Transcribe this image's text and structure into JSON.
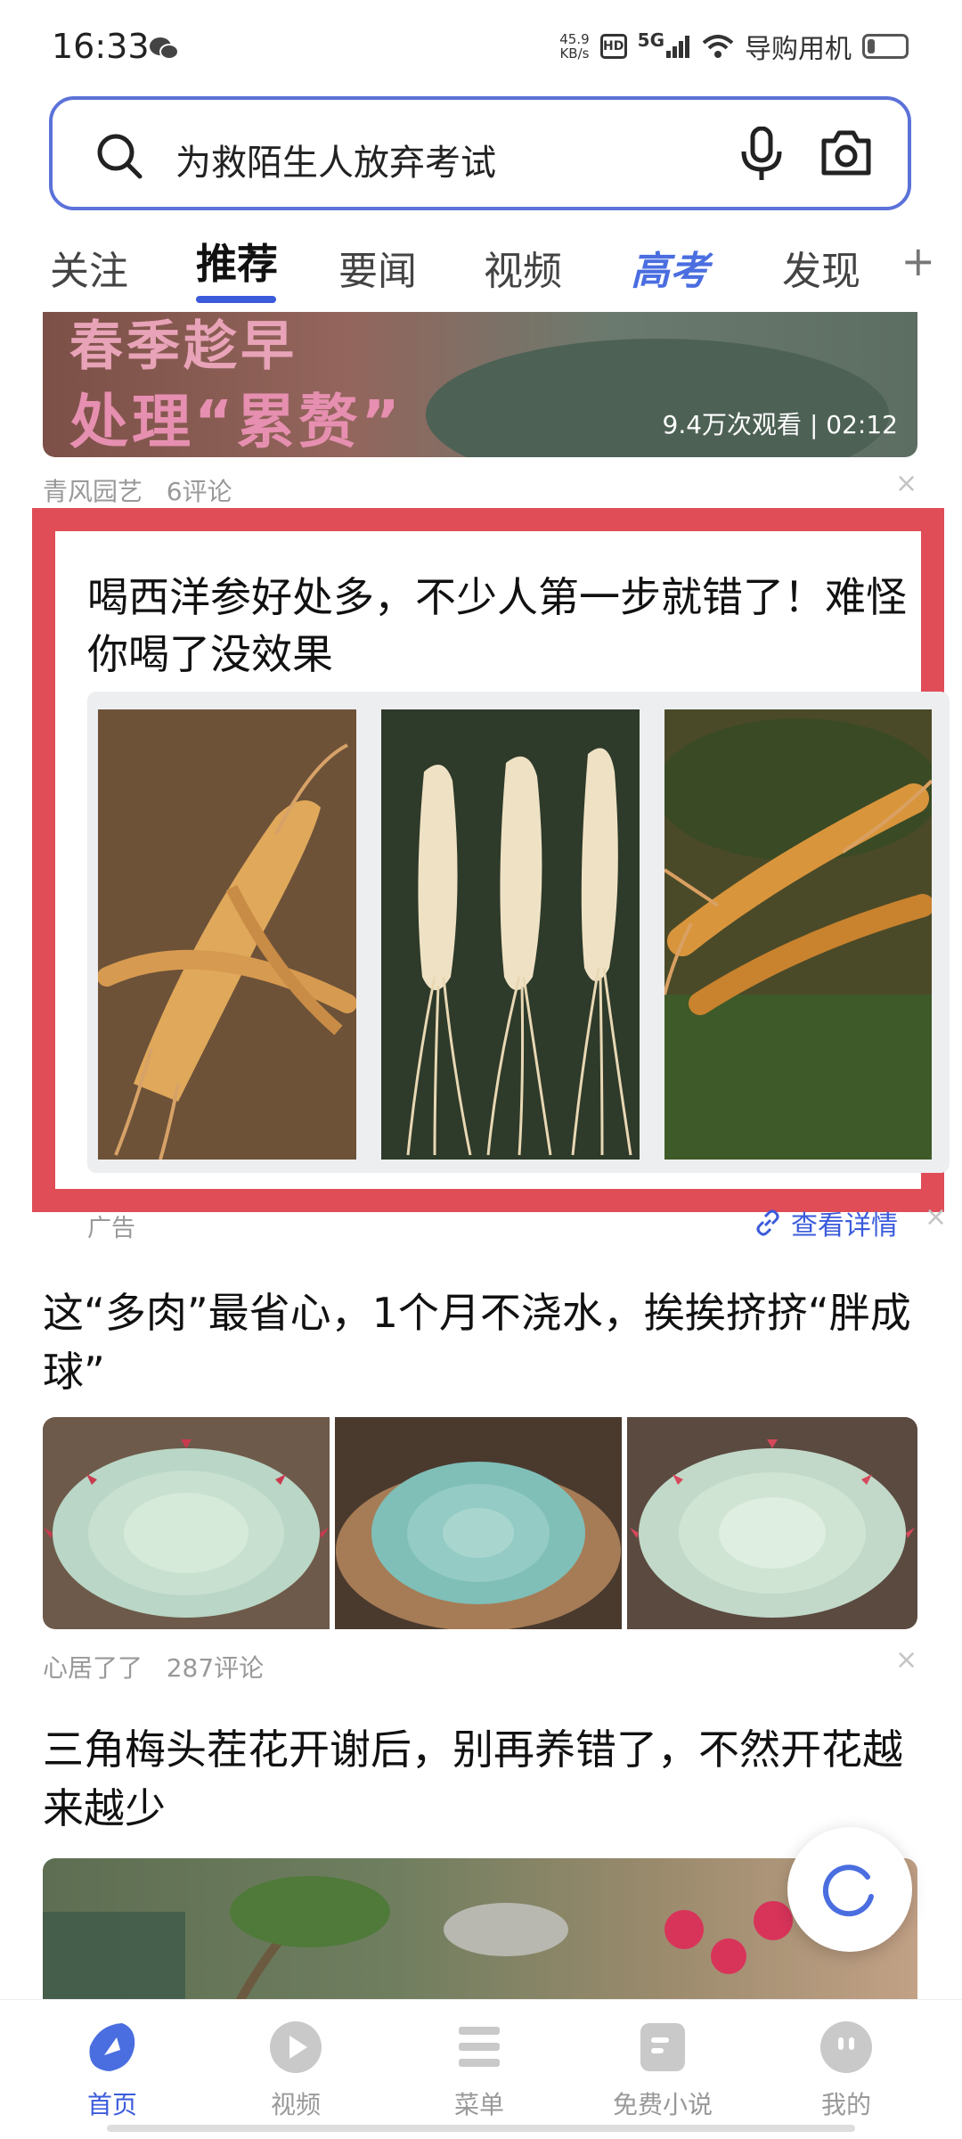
{
  "status_bar": {
    "time": "16:33",
    "net_speed_value": "45.9",
    "net_speed_unit": "KB/s",
    "hd_label": "HD",
    "network": "5G",
    "carrier": "导购用机",
    "battery_level": 0.2
  },
  "search": {
    "query": "为救陌生人放弃考试"
  },
  "tabs": [
    {
      "label": "关注"
    },
    {
      "label": "推荐"
    },
    {
      "label": "要闻"
    },
    {
      "label": "视频"
    },
    {
      "label": "高考"
    },
    {
      "label": "发现"
    }
  ],
  "tab_plus": "+",
  "feed": {
    "item1": {
      "overlay_line1": "春季趁早",
      "overlay_line2": "处理“累赘”",
      "views_duration": "9.4万次观看 | 02:12",
      "source": "青风园艺",
      "comments": "6评论"
    },
    "ad": {
      "title": "喝西洋参好处多，不少人第一步就错了！难怪你喝了没效果",
      "tag": "广告",
      "detail_label": "查看详情"
    },
    "item2": {
      "title": "这“多肉”最省心，1个月不浇水，挨挨挤挤“胖成球”",
      "source": "心居了了",
      "comments": "287评论"
    },
    "item3": {
      "title": "三角梅头茬花开谢后，别再养错了，不然开花越来越少"
    },
    "close_symbol": "×"
  },
  "bottom_nav": [
    {
      "label": "首页",
      "icon": "home-icon"
    },
    {
      "label": "视频",
      "icon": "play-icon"
    },
    {
      "label": "菜单",
      "icon": "menu-icon"
    },
    {
      "label": "免费小说",
      "icon": "book-icon"
    },
    {
      "label": "我的",
      "icon": "profile-icon"
    }
  ],
  "colors": {
    "accent": "#3b5bdb",
    "highlight_frame": "#e04d57"
  }
}
